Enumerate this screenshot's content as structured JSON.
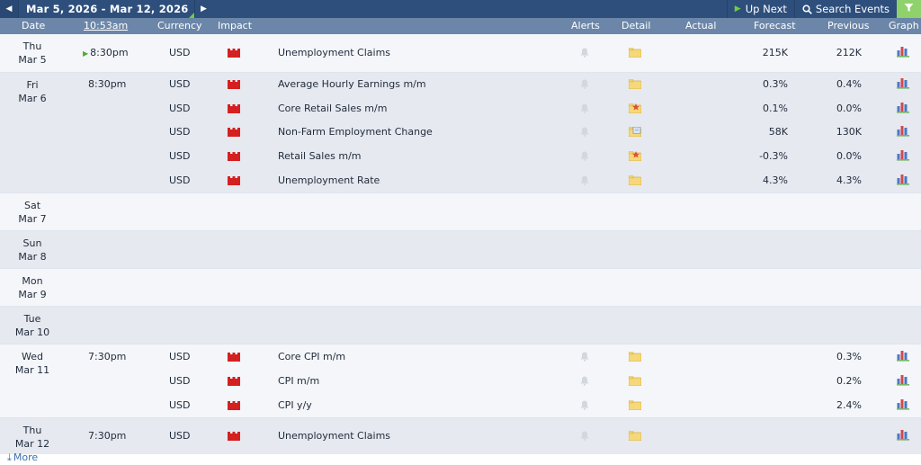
{
  "toolbar": {
    "prev_icon": "triangle-left-icon",
    "next_icon": "triangle-right-icon",
    "date_range": "Mar 5, 2026 - Mar 12, 2026",
    "up_next": "Up Next",
    "search_events": "Search Events",
    "filter_icon": "funnel-icon"
  },
  "columns": {
    "date": "Date",
    "time": "10:53am",
    "currency": "Currency",
    "impact": "Impact",
    "alerts": "Alerts",
    "detail": "Detail",
    "actual": "Actual",
    "forecast": "Forecast",
    "previous": "Previous",
    "graph": "Graph"
  },
  "days": [
    {
      "dow": "Thu",
      "date": "Mar 5",
      "bg": "#f4f6fa",
      "events": [
        {
          "time": "8:30pm",
          "up_next": true,
          "currency": "USD",
          "event": "Unemployment Claims",
          "detail": "folder",
          "actual": "",
          "forecast": "215K",
          "previous": "212K"
        }
      ]
    },
    {
      "dow": "Fri",
      "date": "Mar 6",
      "bg": "#e6e9ef",
      "events": [
        {
          "time": "8:30pm",
          "currency": "USD",
          "event": "Average Hourly Earnings m/m",
          "detail": "folder",
          "actual": "",
          "forecast": "0.3%",
          "previous": "0.4%"
        },
        {
          "time": "",
          "currency": "USD",
          "event": "Core Retail Sales m/m",
          "detail": "folder-star",
          "actual": "",
          "forecast": "0.1%",
          "previous": "0.0%"
        },
        {
          "time": "",
          "currency": "USD",
          "event": "Non-Farm Employment Change",
          "detail": "folder-doc",
          "actual": "",
          "forecast": "58K",
          "previous": "130K"
        },
        {
          "time": "",
          "currency": "USD",
          "event": "Retail Sales m/m",
          "detail": "folder-star",
          "actual": "",
          "forecast": "-0.3%",
          "previous": "0.0%"
        },
        {
          "time": "",
          "currency": "USD",
          "event": "Unemployment Rate",
          "detail": "folder",
          "actual": "",
          "forecast": "4.3%",
          "previous": "4.3%"
        }
      ]
    },
    {
      "dow": "Sat",
      "date": "Mar 7",
      "bg": "#f4f6fa",
      "events": []
    },
    {
      "dow": "Sun",
      "date": "Mar 8",
      "bg": "#e6e9ef",
      "events": []
    },
    {
      "dow": "Mon",
      "date": "Mar 9",
      "bg": "#f4f6fa",
      "events": []
    },
    {
      "dow": "Tue",
      "date": "Mar 10",
      "bg": "#e6e9ef",
      "events": []
    },
    {
      "dow": "Wed",
      "date": "Mar 11",
      "bg": "#f4f6fa",
      "events": [
        {
          "time": "7:30pm",
          "currency": "USD",
          "event": "Core CPI m/m",
          "detail": "folder",
          "actual": "",
          "forecast": "",
          "previous": "0.3%"
        },
        {
          "time": "",
          "currency": "USD",
          "event": "CPI m/m",
          "detail": "folder",
          "actual": "",
          "forecast": "",
          "previous": "0.2%"
        },
        {
          "time": "",
          "currency": "USD",
          "event": "CPI y/y",
          "detail": "folder",
          "actual": "",
          "forecast": "",
          "previous": "2.4%"
        }
      ]
    },
    {
      "dow": "Thu",
      "date": "Mar 12",
      "bg": "#e6e9ef",
      "events": [
        {
          "time": "7:30pm",
          "currency": "USD",
          "event": "Unemployment Claims",
          "detail": "folder",
          "actual": "",
          "forecast": "",
          "previous": ""
        }
      ]
    }
  ],
  "more": "More",
  "colors": {
    "toolbar": "#2e4f7c",
    "header": "#6b86a8",
    "impact_high": "#d42020",
    "accent_green": "#6fcf3f"
  }
}
